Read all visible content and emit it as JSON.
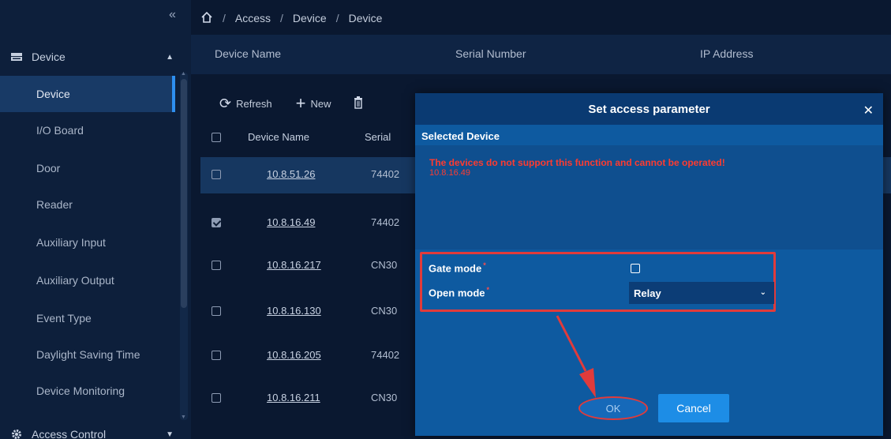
{
  "breadcrumb": {
    "home_icon": "home-icon",
    "items": [
      "Access",
      "Device",
      "Device"
    ],
    "separator": "/"
  },
  "sidebar": {
    "collapse_icon": "double-chevron-left-icon",
    "group_device": {
      "label": "Device",
      "icon": "device-icon"
    },
    "items": [
      {
        "label": "Device"
      },
      {
        "label": "I/O Board"
      },
      {
        "label": "Door"
      },
      {
        "label": "Reader"
      },
      {
        "label": "Auxiliary Input"
      },
      {
        "label": "Auxiliary Output"
      },
      {
        "label": "Event Type"
      },
      {
        "label": "Daylight Saving Time"
      },
      {
        "label": "Device Monitoring"
      }
    ],
    "group_access": {
      "label": "Access Control",
      "icon": "gear-icon"
    }
  },
  "header": {
    "columns": [
      "Device Name",
      "Serial Number",
      "IP Address"
    ]
  },
  "toolbar": {
    "refresh_label": "Refresh",
    "new_label": "New"
  },
  "table": {
    "headers": {
      "name": "Device Name",
      "serial": "Serial"
    },
    "rows": [
      {
        "name": "10.8.51.26",
        "serial": "74402",
        "checked": false
      },
      {
        "name": "10.8.16.49",
        "serial": "74402",
        "checked": true
      },
      {
        "name": "10.8.16.217",
        "serial": "CN30",
        "checked": false
      },
      {
        "name": "10.8.16.130",
        "serial": "CN30",
        "checked": false
      },
      {
        "name": "10.8.16.205",
        "serial": "74402",
        "checked": false
      },
      {
        "name": "10.8.16.211",
        "serial": "CN30",
        "checked": false
      }
    ]
  },
  "modal": {
    "title": "Set access parameter",
    "close_icon": "close-icon",
    "selected_label": "Selected Device",
    "error_text": "The devices do not support this function and cannot be operated!",
    "error_device": "10.8.16.49",
    "gate_mode_label": "Gate mode",
    "gate_mode_required": "*",
    "open_mode_label": "Open mode",
    "open_mode_required": "*",
    "open_mode_value": "Relay",
    "ok_label": "OK",
    "cancel_label": "Cancel"
  },
  "colors": {
    "accent": "#1d8de6",
    "highlight": "#e13b3b",
    "error": "#ff3b30"
  }
}
